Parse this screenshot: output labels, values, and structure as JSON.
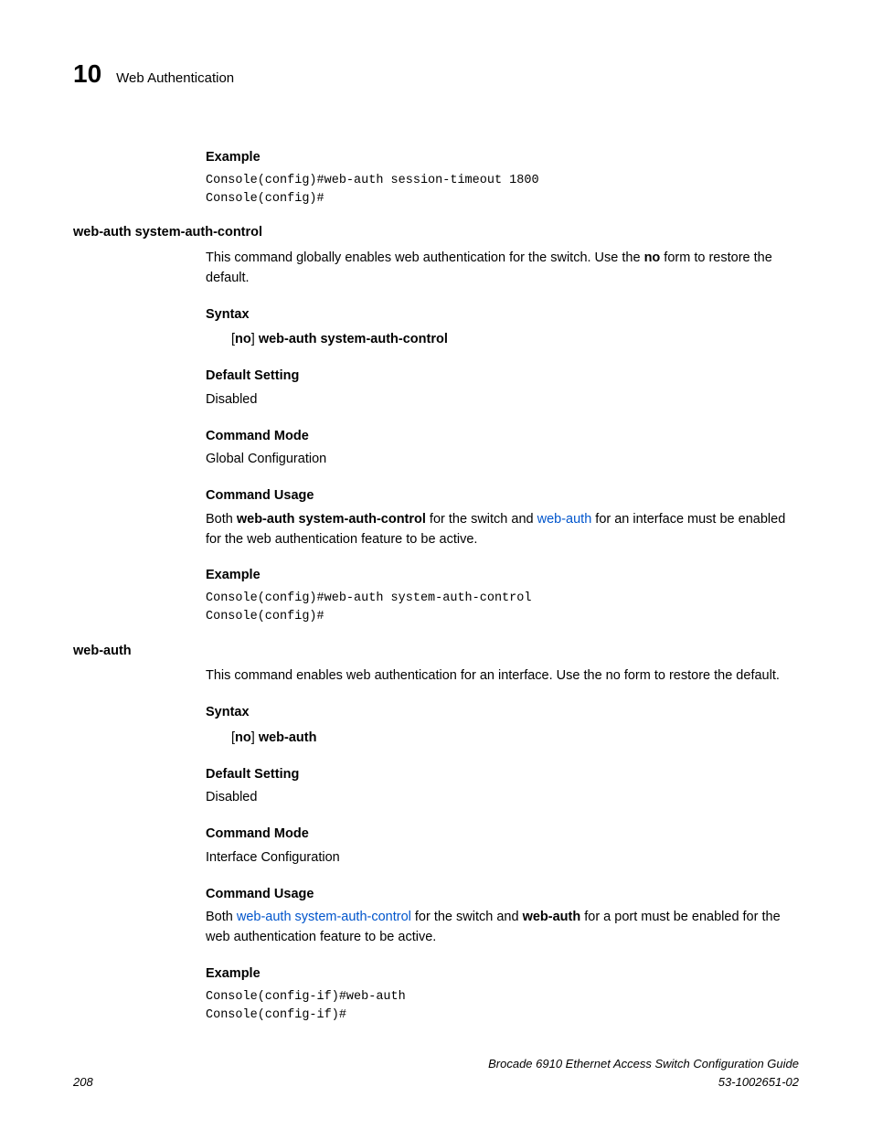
{
  "header": {
    "chapter": "10",
    "title": "Web Authentication"
  },
  "sec1": {
    "example_h": "Example",
    "code": "Console(config)#web-auth session-timeout 1800\nConsole(config)#"
  },
  "cmd1": {
    "left": "web-auth system-auth-control",
    "desc1": "This command globally enables web authentication for the switch. Use the ",
    "desc_no": "no",
    "desc2": " form to restore the default.",
    "syntax_h": "Syntax",
    "syntax_br1": "[",
    "syntax_no": "no",
    "syntax_br2": "] ",
    "syntax_cmd": "web-auth system-auth-control",
    "default_h": "Default Setting",
    "default_v": "Disabled",
    "mode_h": "Command Mode",
    "mode_v": "Global Configuration",
    "usage_h": "Command Usage",
    "u1": "Both ",
    "u2": "web-auth system-auth-control",
    "u3": " for the switch and ",
    "u4": "web-auth",
    "u5": " for an interface must be enabled for the web authentication feature to be active.",
    "example_h": "Example",
    "code": "Console(config)#web-auth system-auth-control\nConsole(config)#"
  },
  "cmd2": {
    "left": "web-auth",
    "desc": "This command enables web authentication for an interface. Use the no form to restore the default.",
    "syntax_h": "Syntax",
    "syntax_br1": "[",
    "syntax_no": "no",
    "syntax_br2": "] ",
    "syntax_cmd": "web-auth",
    "default_h": "Default Setting",
    "default_v": "Disabled",
    "mode_h": "Command Mode",
    "mode_v": "Interface Configuration",
    "usage_h": "Command Usage",
    "u1": "Both ",
    "u2": "web-auth system-auth-control",
    "u3": " for the switch and ",
    "u4": "web-auth",
    "u5": " for a port must be enabled for the web authentication feature to be active.",
    "example_h": "Example",
    "code": "Console(config-if)#web-auth\nConsole(config-if)#"
  },
  "footer": {
    "page": "208",
    "book": "Brocade 6910 Ethernet Access Switch Configuration Guide",
    "doc": "53-1002651-02"
  }
}
